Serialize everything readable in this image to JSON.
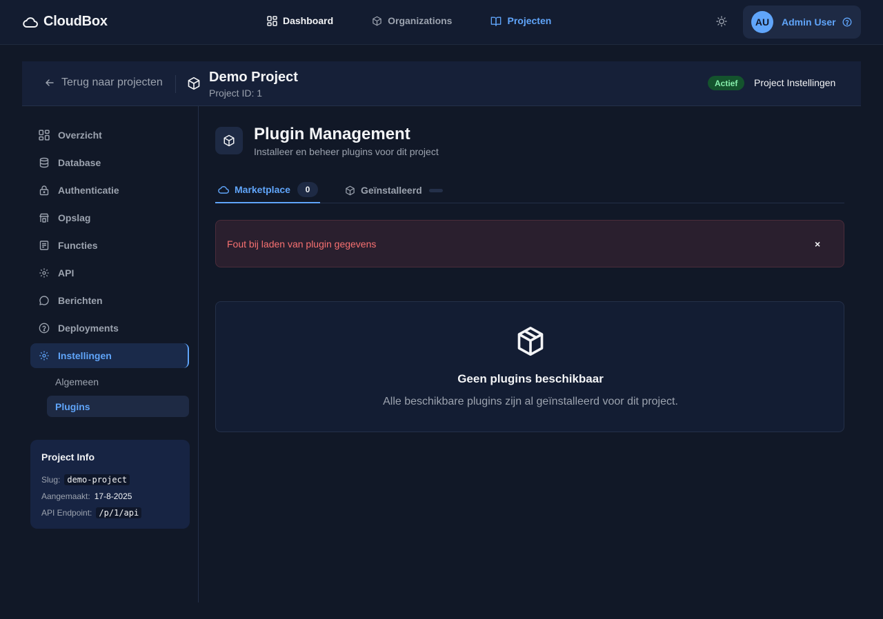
{
  "brand": {
    "name": "CloudBox"
  },
  "nav": {
    "items": [
      {
        "label": "Dashboard"
      },
      {
        "label": "Organizations"
      },
      {
        "label": "Projecten"
      }
    ]
  },
  "user": {
    "initials": "AU",
    "name": "Admin User"
  },
  "project": {
    "back_label": "Terug naar projecten",
    "title": "Demo Project",
    "id_label": "Project ID: 1",
    "status": "Actief",
    "settings_label": "Project Instellingen"
  },
  "sidebar": {
    "items": [
      {
        "label": "Overzicht"
      },
      {
        "label": "Database"
      },
      {
        "label": "Authenticatie"
      },
      {
        "label": "Opslag"
      },
      {
        "label": "Functies"
      },
      {
        "label": "API"
      },
      {
        "label": "Berichten"
      },
      {
        "label": "Deployments"
      },
      {
        "label": "Instellingen"
      }
    ],
    "sub_items": [
      {
        "label": "Algemeen"
      },
      {
        "label": "Plugins"
      }
    ],
    "info": {
      "title": "Project Info",
      "slug_label": "Slug:",
      "slug": "demo-project",
      "created_label": "Aangemaakt:",
      "created": "17-8-2025",
      "endpoint_label": "API Endpoint:",
      "endpoint": "/p/1/api"
    }
  },
  "main": {
    "title": "Plugin Management",
    "subtitle": "Installeer en beheer plugins voor dit project",
    "tabs": [
      {
        "label": "Marketplace",
        "count": "0"
      },
      {
        "label": "Geïnstalleerd",
        "count": ""
      }
    ],
    "error": {
      "message": "Fout bij laden van plugin gegevens",
      "close": "×"
    },
    "empty": {
      "title": "Geen plugins beschikbaar",
      "description": "Alle beschikbare plugins zijn al geïnstalleerd voor dit project."
    }
  },
  "colors": {
    "background": "#111827",
    "accent": "#60a5fa",
    "error": "#f87171",
    "success": "#86efac"
  }
}
